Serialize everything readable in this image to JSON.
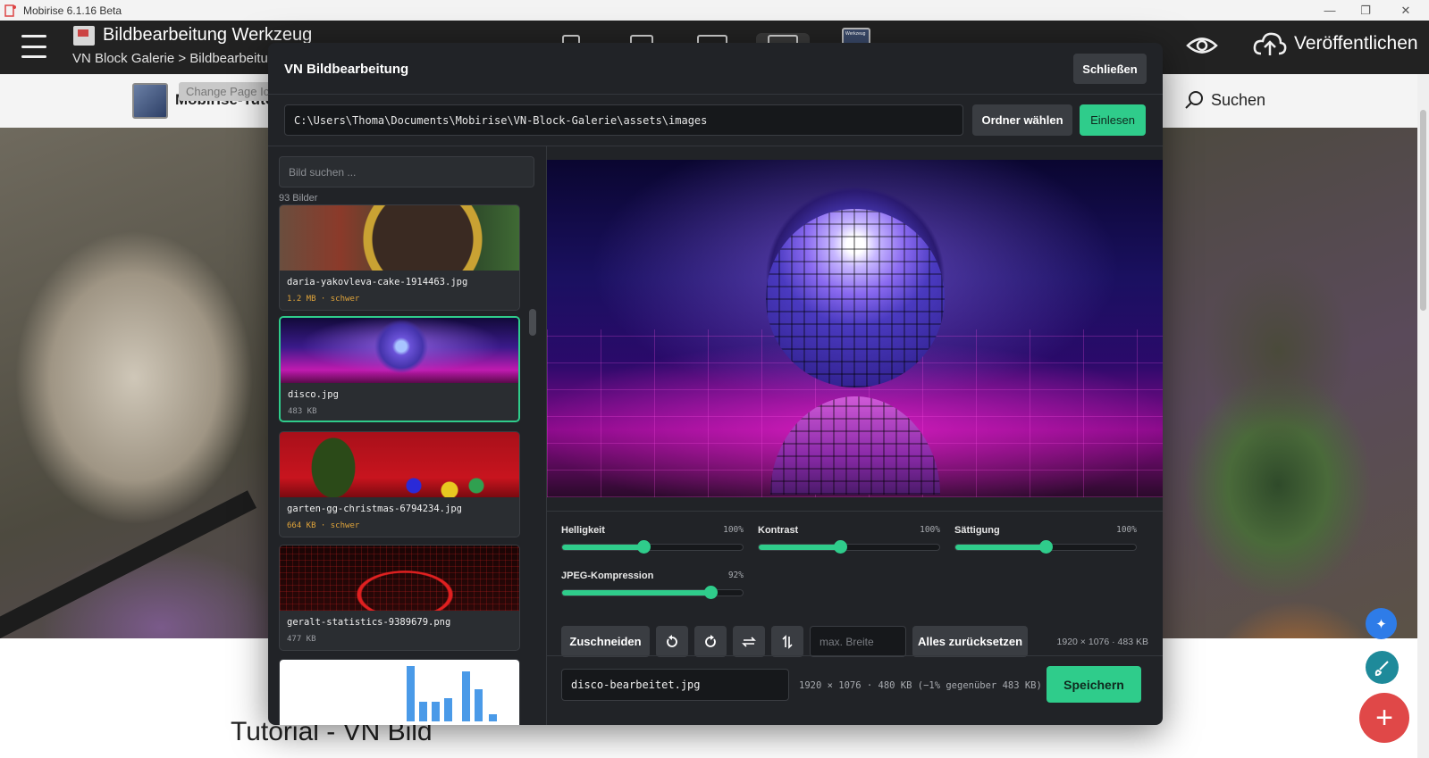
{
  "window": {
    "title": "Mobirise 6.1.16 Beta",
    "controls": [
      "—",
      "❐",
      "✕"
    ]
  },
  "header": {
    "project_title": "Bildbearbeitung Werkzeug",
    "breadcrumb": "VN Block Galerie > Bildbearbeitung",
    "thumb_text": "Werkzeug",
    "publish_label": "Veröffentlichen"
  },
  "site": {
    "brand": "Mobirise-Tutorials",
    "tooltip": "Change Page Icon",
    "search_label": "Suchen",
    "tutorial_title": "Tutorial - VN Bild"
  },
  "modal": {
    "title": "VN Bildbearbeitung",
    "close_label": "Schließen",
    "path_value": "C:\\Users\\Thoma\\Documents\\Mobirise\\VN-Block-Galerie\\assets\\images",
    "folder_label": "Ordner wählen",
    "load_label": "Einlesen",
    "search_placeholder": "Bild suchen ...",
    "image_count": "93 Bilder",
    "images": [
      {
        "name": "daria-yakovleva-cake-1914463.jpg",
        "meta": "1.2 MB · schwer",
        "heavy": true,
        "selected": false
      },
      {
        "name": "disco.jpg",
        "meta": "483 KB",
        "heavy": false,
        "selected": true
      },
      {
        "name": "garten-gg-christmas-6794234.jpg",
        "meta": "664 KB · schwer",
        "heavy": true,
        "selected": false
      },
      {
        "name": "geralt-statistics-9389679.png",
        "meta": "477 KB",
        "heavy": false,
        "selected": false
      },
      {
        "name": "",
        "meta": "",
        "heavy": false,
        "selected": false
      }
    ],
    "sliders": [
      {
        "label": "Helligkeit",
        "value": "100%",
        "level": 0.45
      },
      {
        "label": "Kontrast",
        "value": "100%",
        "level": 0.45
      },
      {
        "label": "Sättigung",
        "value": "100%",
        "level": 0.5
      },
      {
        "label": "JPEG-Kompression",
        "value": "92%",
        "level": 0.82
      }
    ],
    "tools": {
      "crop_label": "Zuschneiden",
      "rotate_left_icon": "rotate-left-icon",
      "rotate_right_icon": "rotate-right-icon",
      "flip_h_icon": "flip-horizontal-icon",
      "flip_v_icon": "flip-vertical-icon",
      "max_width_placeholder": "max. Breite",
      "reset_label": "Alles zurücksetzen",
      "dimensions": "1920 × 1076 · 483 KB"
    },
    "footer": {
      "output_name": "disco-bearbeitet.jpg",
      "output_info": "1920 × 1076 · 480 KB (−1% gegenüber 483 KB)",
      "save_label": "Speichern"
    }
  },
  "colors": {
    "accent": "#2fcc8b",
    "modal_bg": "#212327",
    "heavy": "#e0a43a",
    "fab_add": "#e04848"
  }
}
